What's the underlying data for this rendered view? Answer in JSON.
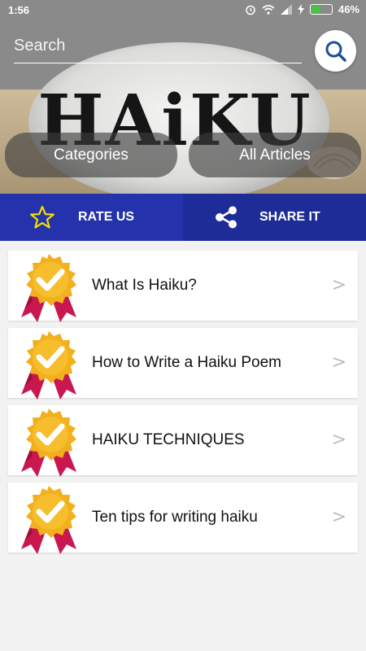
{
  "status_bar": {
    "time": "1:56",
    "battery_percent": "46%",
    "battery_level": 0.46,
    "icons": [
      "alarm-icon",
      "wifi-icon",
      "signal-icon",
      "charging-icon",
      "battery-icon"
    ]
  },
  "hero": {
    "logo_text": "HAiKU",
    "search": {
      "placeholder": "Search",
      "value": ""
    },
    "categories_label": "Categories",
    "all_articles_label": "All Articles"
  },
  "actions": {
    "rate_label": "RATE US",
    "share_label": "SHARE IT"
  },
  "articles": [
    {
      "title": "What Is Haiku?",
      "chevron": ">"
    },
    {
      "title": "How to Write a Haiku Poem",
      "chevron": ">"
    },
    {
      "title": "HAIKU TECHNIQUES",
      "chevron": ">"
    },
    {
      "title": "Ten tips for writing haiku",
      "chevron": ">"
    }
  ],
  "colors": {
    "action_bar_primary": "#2433ab",
    "action_bar_secondary": "#1e2c97",
    "badge_gold": "#f2b01e",
    "badge_ribbon": "#c8184f",
    "search_icon": "#1a4f9c",
    "star_icon": "#f3e000"
  }
}
